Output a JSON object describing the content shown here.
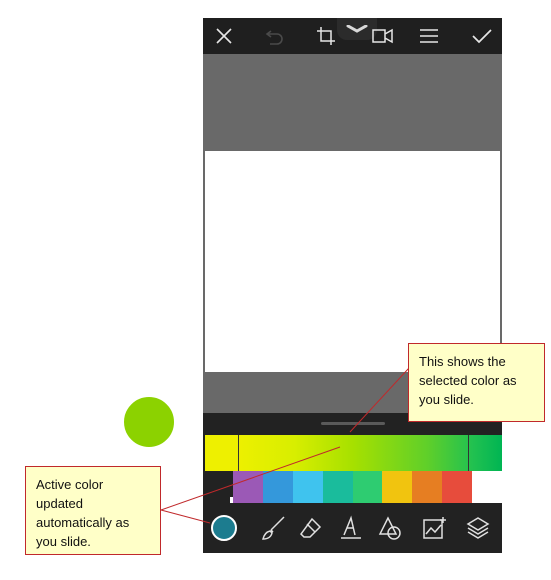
{
  "colors": {
    "active": "#1c7c8f",
    "selected": "#8cd200",
    "callout_bg": "#ffffc8",
    "callout_border": "#c0292b"
  },
  "topbar": {
    "icons": [
      "close-icon",
      "undo-icon",
      "crop-icon",
      "video-icon",
      "menu-icon",
      "check-icon"
    ]
  },
  "swatches": [
    "#9b59b6",
    "#3498db",
    "#3fc3ee",
    "#1abc9c",
    "#2ecc71",
    "#f1c40f",
    "#e67e22",
    "#e74c3c",
    "#ffffff"
  ],
  "tools": [
    "brush-icon",
    "eraser-icon",
    "text-icon",
    "shape-icon",
    "image-icon",
    "layers-icon"
  ],
  "callouts": {
    "selected_color": "This shows the\nselected color as\nyou slide.",
    "active_color": "Active color\nupdated\nautomatically as\nyou slide."
  }
}
